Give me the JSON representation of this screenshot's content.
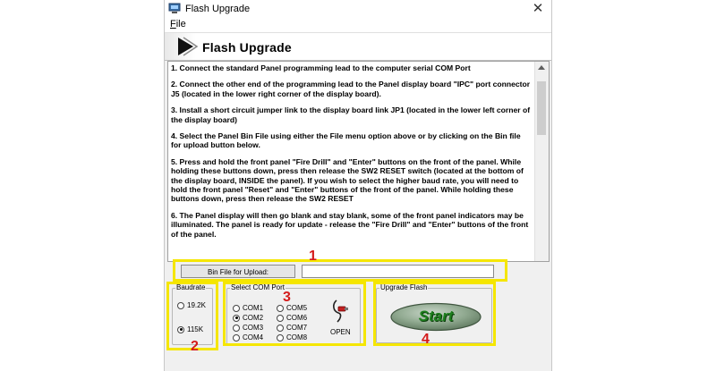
{
  "window": {
    "title": "Flash Upgrade",
    "close_glyph": "✕"
  },
  "menu": {
    "file_initial": "F",
    "file_rest": "ile"
  },
  "banner": {
    "title": "Flash Upgrade"
  },
  "instructions": [
    "1. Connect the standard Panel programming lead to the computer serial COM Port",
    "2. Connect the other end of the programming lead to the Panel display board \"IPC\" port connector J5 (located in the lower right corner of the display board).",
    "3. Install a short circuit jumper link to the display board link JP1 (located in the lower left corner of the display board)",
    "4. Select the Panel Bin File using either the File menu option above or by clicking on the Bin file for upload button below.",
    "5. Press and hold the front panel \"Fire Drill\" and \"Enter\" buttons on the front of the panel. While holding these buttons down, press then release the SW2 RESET switch (located at the bottom of the display board, INSIDE the panel). If you wish to select the higher baud rate, you will need to hold the front panel \"Reset\" and \"Enter\" buttons of the front of the panel. While holding these buttons down, press then release the SW2 RESET",
    "6. The Panel display will then go blank and stay blank, some of the front panel indicators may be illuminated. The panel is ready for update - release the \"Fire Drill\" and \"Enter\" buttons of the front of the panel."
  ],
  "bin_file": {
    "button_label": "Bin File for Upload:",
    "value": ""
  },
  "baudrate": {
    "label": "Baudrate",
    "options": [
      "19.2K",
      "115K"
    ],
    "selected": "115K"
  },
  "com_port": {
    "label": "Select COM Port",
    "options": [
      "COM1",
      "COM2",
      "COM3",
      "COM4",
      "COM5",
      "COM6",
      "COM7",
      "COM8"
    ],
    "selected": "COM2",
    "open_label": "OPEN"
  },
  "upgrade": {
    "label": "Upgrade Flash",
    "start_label": "Start"
  },
  "callouts": [
    "1",
    "2",
    "3",
    "4"
  ],
  "colors": {
    "highlight": "#f5e600",
    "callout": "#d41a1a",
    "start_green": "#3b9a3b"
  }
}
